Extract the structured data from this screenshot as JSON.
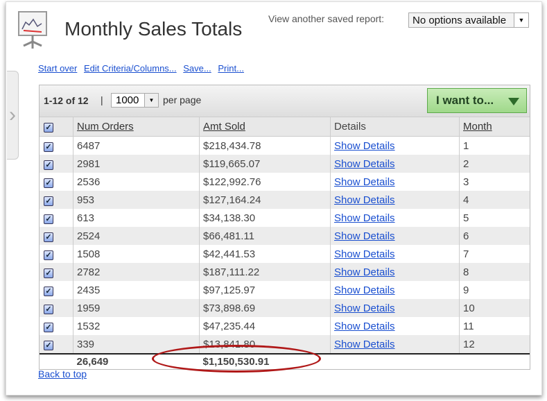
{
  "title": "Monthly Sales Totals",
  "saved_report": {
    "label": "View another saved report:",
    "value": "No options available"
  },
  "links": [
    "Start over",
    "Edit Criteria/Columns...",
    "Save...",
    "Print..."
  ],
  "toolbar": {
    "count": "1-12 of 12",
    "sep": "|",
    "per_page_value": "1000",
    "per_page_label": "per page",
    "action": "I want to..."
  },
  "columns": [
    "Num Orders",
    "Amt Sold",
    "Details",
    "Month"
  ],
  "rows": [
    [
      "6487",
      "$218,434.78",
      "Show Details",
      "1"
    ],
    [
      "2981",
      "$119,665.07",
      "Show Details",
      "2"
    ],
    [
      "2536",
      "$122,992.76",
      "Show Details",
      "3"
    ],
    [
      "953",
      "$127,164.24",
      "Show Details",
      "4"
    ],
    [
      "613",
      "$34,138.30",
      "Show Details",
      "5"
    ],
    [
      "2524",
      "$66,481.11",
      "Show Details",
      "6"
    ],
    [
      "1508",
      "$42,441.53",
      "Show Details",
      "7"
    ],
    [
      "2782",
      "$187,111.22",
      "Show Details",
      "8"
    ],
    [
      "2435",
      "$97,125.97",
      "Show Details",
      "9"
    ],
    [
      "1959",
      "$73,898.69",
      "Show Details",
      "10"
    ],
    [
      "1532",
      "$47,235.44",
      "Show Details",
      "11"
    ],
    [
      "339",
      "$13,841.80",
      "Show Details",
      "12"
    ]
  ],
  "totals": {
    "orders": "26,649",
    "amount": "$1,150,530.91"
  },
  "back_to_top": "Back to top"
}
